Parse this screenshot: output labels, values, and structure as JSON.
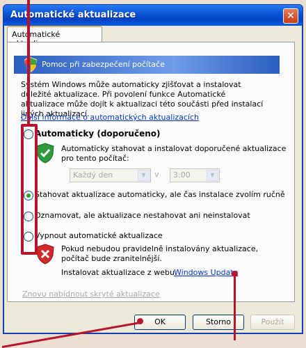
{
  "window": {
    "title": "Automatické aktualizace",
    "close_glyph": "✕"
  },
  "tab": {
    "label": "Automatické aktualizace"
  },
  "banner": {
    "text": "Pomoc při zabezpečení počítače"
  },
  "intro": {
    "text": "Systém Windows může automaticky zjišťovat a instalovat důležité aktualizace. Při povolení funkce Automatické aktualizace může dojít k aktualizaci této součásti před instalací jiných aktualizací.",
    "more_link": "Další informace o automatických aktualizacích"
  },
  "options": {
    "auto": {
      "label": "Automaticky (doporučeno)",
      "desc": "Automaticky stahovat a instalovat doporučené aktualizace pro tento počítač:",
      "checked": false
    },
    "schedule": {
      "day": "Každý den",
      "at": "v",
      "time": "3:00"
    },
    "download": {
      "label": "Stahovat aktualizace automaticky, ale čas instalace zvolím ručně",
      "checked": true
    },
    "notify": {
      "label": "Oznamovat, ale aktualizace nestahovat ani neinstalovat",
      "checked": false
    },
    "off": {
      "label": "Vypnout automatické aktualizace",
      "checked": false
    }
  },
  "warning": {
    "text": "Pokud nebudou pravidelně instalovány aktualizace, počítač bude zranitelnější.",
    "install_prefix": "Instalovat aktualizace z webu",
    "install_link": "Windows Update"
  },
  "hidden_link": "Znovu nabídnout skryté aktualizace",
  "buttons": {
    "ok": "OK",
    "cancel": "Storno",
    "apply": "Použít"
  },
  "colors": {
    "annotation": "#b8132a",
    "title_bar": "#0a56d8",
    "link": "#0034cc"
  }
}
